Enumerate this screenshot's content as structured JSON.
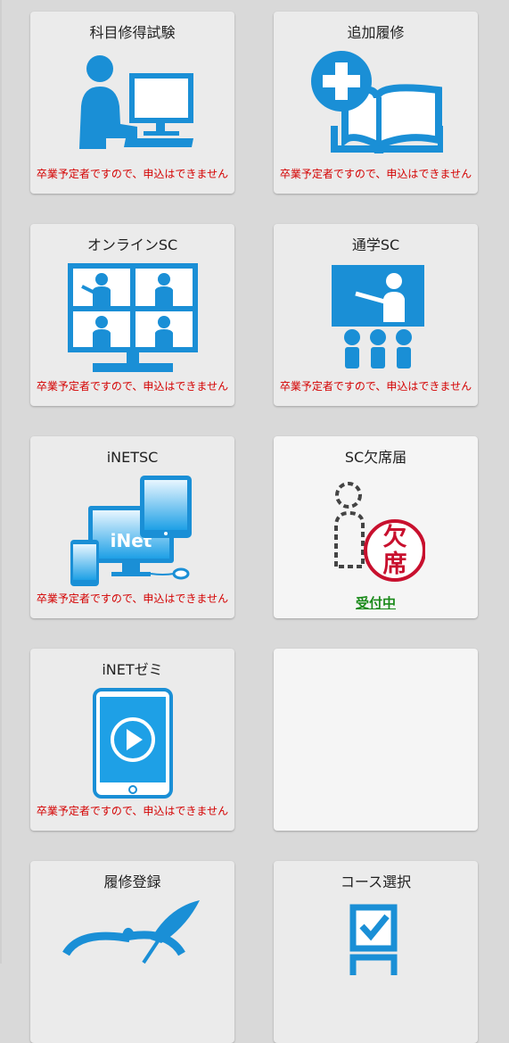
{
  "colors": {
    "accent": "#1a8fd6",
    "notice": "#d40000",
    "status_ok": "#1a8a1a",
    "stamp": "#c8102e"
  },
  "cards": [
    {
      "title": "科目修得試験",
      "icon": "student-computer-icon",
      "notice": "卒業予定者ですので、申込はできません"
    },
    {
      "title": "追加履修",
      "icon": "add-book-icon",
      "notice": "卒業予定者ですので、申込はできません"
    },
    {
      "title": "オンラインSC",
      "icon": "online-class-icon",
      "notice": "卒業予定者ですので、申込はできません"
    },
    {
      "title": "通学SC",
      "icon": "classroom-lecture-icon",
      "notice": "卒業予定者ですので、申込はできません"
    },
    {
      "title": "iNETSC",
      "icon": "inet-devices-icon",
      "notice": "卒業予定者ですので、申込はできません",
      "icon_text": "iNet"
    },
    {
      "title": "SC欠席届",
      "icon": "absence-stamp-icon",
      "status": "受付中",
      "stamp_top": "欠",
      "stamp_bottom": "席"
    },
    {
      "title": "iNETゼミ",
      "icon": "tablet-video-icon",
      "notice": "卒業予定者ですので、申込はできません"
    },
    {
      "title": "",
      "icon": ""
    },
    {
      "title": "履修登録",
      "icon": "course-registration-icon"
    },
    {
      "title": "コース選択",
      "icon": "course-select-icon"
    }
  ]
}
